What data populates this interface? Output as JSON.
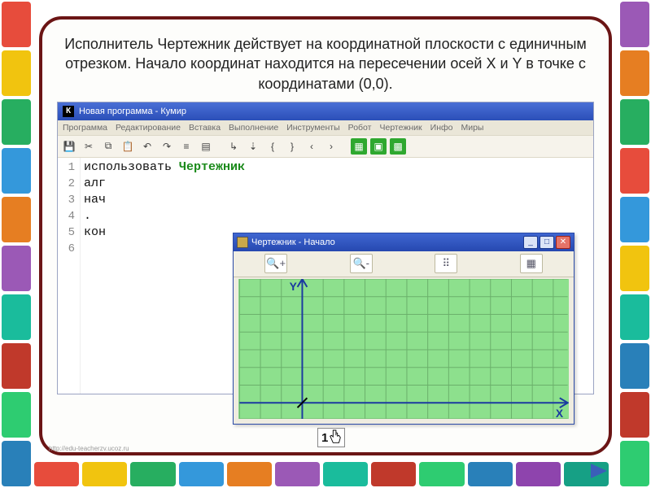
{
  "slide": {
    "heading": "Исполнитель Чертежник действует на координатной плоскости с единичным отрезком. Начало координат находится на пересечении осей X и Y  в точке с координатами (0,0).",
    "footer_url": "http://edu-teacherzv.ucoz.ru",
    "page_num": "1"
  },
  "app": {
    "title": "Новая программа - Кумир",
    "menu": [
      "Программа",
      "Редактирование",
      "Вставка",
      "Выполнение",
      "Инструменты",
      "Робот",
      "Чертежник",
      "Инфо",
      "Миры"
    ],
    "code_lines": [
      {
        "n": "1",
        "text": "использовать ",
        "tail": "Чертежник"
      },
      {
        "n": "2",
        "text": "алг"
      },
      {
        "n": "3",
        "text": "нач"
      },
      {
        "n": "4",
        "text": "."
      },
      {
        "n": "5",
        "text": "кон"
      },
      {
        "n": "6",
        "text": ""
      }
    ]
  },
  "inner": {
    "title": "Чертежник - Начало",
    "axis_x": "X",
    "axis_y": "Y"
  },
  "crayon_colors": [
    "#e74c3c",
    "#f1c40f",
    "#27ae60",
    "#3498db",
    "#e67e22",
    "#9b59b6",
    "#1abc9c",
    "#c0392b",
    "#2ecc71",
    "#2980b9"
  ]
}
